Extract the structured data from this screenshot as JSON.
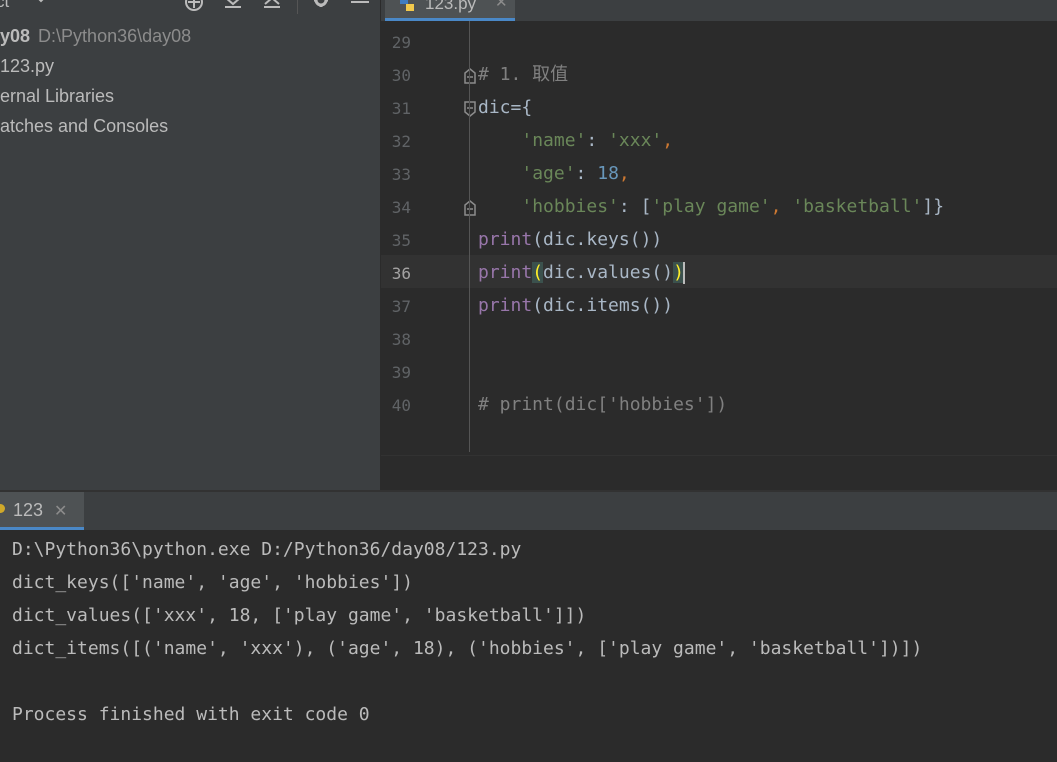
{
  "project": {
    "title": "ct",
    "tree": [
      {
        "name_bold": "y08",
        "path": "D:\\Python36\\day08"
      },
      {
        "label": "123.py"
      },
      {
        "label": "ernal Libraries"
      },
      {
        "label": "atches and Consoles"
      }
    ]
  },
  "editor": {
    "tab_label": "123.py",
    "line_numbers": [
      "29",
      "30",
      "31",
      "32",
      "33",
      "34",
      "35",
      "36",
      "37",
      "38",
      "39",
      "40"
    ],
    "active_line": "36",
    "code": {
      "l30": "# 1. 取值",
      "l31_var": "dic",
      "l31_op": "={",
      "l32_key": "'name'",
      "l32_val": "'xxx'",
      "l33_key": "'age'",
      "l33_val": "18",
      "l34_key": "'hobbies'",
      "l34_item1": "'play game'",
      "l34_item2": "'basketball'",
      "print_kw": "print",
      "l35_arg": "dic.keys()",
      "l36_arg": "dic.values()",
      "l37_arg": "dic.items()",
      "l40": "# print(dic['hobbies'])"
    }
  },
  "run": {
    "tab_label": "123",
    "output": [
      "D:\\Python36\\python.exe D:/Python36/day08/123.py",
      "dict_keys(['name', 'age', 'hobbies'])",
      "dict_values(['xxx', 18, ['play game', 'basketball']])",
      "dict_items([('name', 'xxx'), ('age', 18), ('hobbies', ['play game', 'basketball'])])",
      "",
      "Process finished with exit code 0"
    ]
  },
  "colors": {
    "keyword": "#9876aa",
    "string": "#6a8759",
    "number": "#6897bb",
    "comment": "#808080",
    "punctuation": "#cc7832",
    "accent": "#4a88c7"
  },
  "icons": [
    "locate-icon",
    "collapse-all-icon",
    "expand-all-icon",
    "gear-icon",
    "minimize-icon",
    "python-file-icon",
    "fold-marker-icon"
  ]
}
